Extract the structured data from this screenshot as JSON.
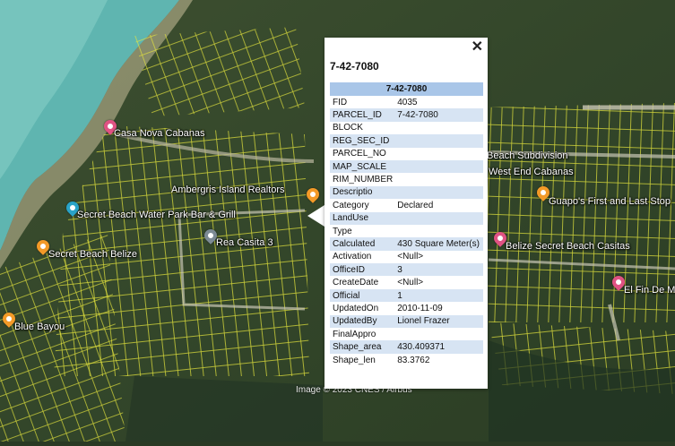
{
  "map": {
    "copyright": "Image © 2023 CNES / Airbus",
    "places": [
      {
        "name": "Casa Nova Cabanas",
        "icon": "pink-pin-icon"
      },
      {
        "name": "Ambergris Island Realtors",
        "icon": "orange-pin-icon"
      },
      {
        "name": "Secret Beach Water Park Bar & Grill",
        "icon": "teal-pin-icon"
      },
      {
        "name": "Rea Casita 3",
        "icon": "grey-pin-icon"
      },
      {
        "name": "Secret Beach Belize",
        "icon": "orange-pin-icon"
      },
      {
        "name": "Blue Bayou",
        "icon": "orange-pin-icon"
      },
      {
        "name": "Beach Subdivision",
        "icon": "none"
      },
      {
        "name": "West End Cabanas",
        "icon": "none"
      },
      {
        "name": "Guapo's First and Last Stop",
        "icon": "orange-pin-icon"
      },
      {
        "name": "Belize Secret Beach Casitas",
        "icon": "pink-pin-icon"
      },
      {
        "name": "El Fin De M",
        "icon": "pink-pin-icon"
      }
    ],
    "colors": {
      "parcel_lines": "#e6e63c",
      "water": "#5fb5b0"
    }
  },
  "popup": {
    "title": "7-42-7080",
    "table_header": "7-42-7080",
    "rows": [
      {
        "key": "FID",
        "value": "4035"
      },
      {
        "key": "PARCEL_ID",
        "value": "7-42-7080"
      },
      {
        "key": "BLOCK",
        "value": ""
      },
      {
        "key": "REG_SEC_ID",
        "value": ""
      },
      {
        "key": "PARCEL_NO",
        "value": ""
      },
      {
        "key": "MAP_SCALE",
        "value": ""
      },
      {
        "key": "RIM_NUMBER",
        "value": ""
      },
      {
        "key": "Descriptio",
        "value": ""
      },
      {
        "key": "Category",
        "value": "Declared"
      },
      {
        "key": "LandUse",
        "value": ""
      },
      {
        "key": "Type",
        "value": ""
      },
      {
        "key": "Calculated",
        "value": "430 Square Meter(s)"
      },
      {
        "key": "Activation",
        "value": "<Null>"
      },
      {
        "key": "OfficeID",
        "value": "3"
      },
      {
        "key": "CreateDate",
        "value": "<Null>"
      },
      {
        "key": "Official",
        "value": "1"
      },
      {
        "key": "UpdatedOn",
        "value": "2010-11-09"
      },
      {
        "key": "UpdatedBy",
        "value": "Lionel Frazer"
      },
      {
        "key": "FinalAppro",
        "value": ""
      },
      {
        "key": "Shape_area",
        "value": "430.409371"
      },
      {
        "key": "Shape_len",
        "value": "83.3762"
      }
    ]
  }
}
